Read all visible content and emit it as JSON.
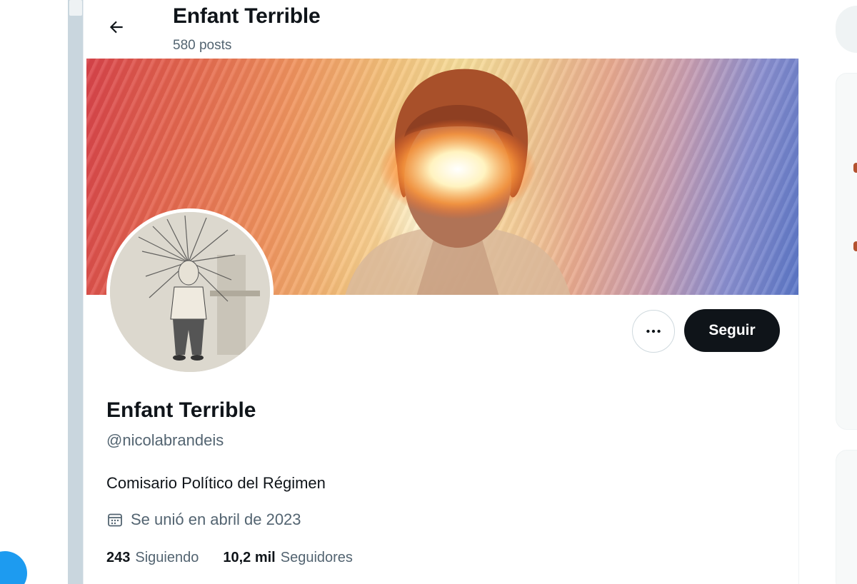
{
  "header": {
    "title": "Enfant Terrible",
    "post_count": "580 posts"
  },
  "profile": {
    "display_name": "Enfant Terrible",
    "handle": "@nicolabrandeis",
    "bio": "Comisario Político del Régimen",
    "joined": "Se unió en abril de 2023",
    "follow_label": "Seguir",
    "following": {
      "count": "243",
      "label": "Siguiendo"
    },
    "followers": {
      "count": "10,2 mil",
      "label": "Seguidores"
    }
  },
  "icons": {
    "back": "arrow-left-icon",
    "more": "more-horizontal-icon",
    "calendar": "calendar-icon"
  },
  "colors": {
    "accent": "#1d9bf0",
    "follow_button": "#0f1419",
    "muted_text": "#536471"
  }
}
